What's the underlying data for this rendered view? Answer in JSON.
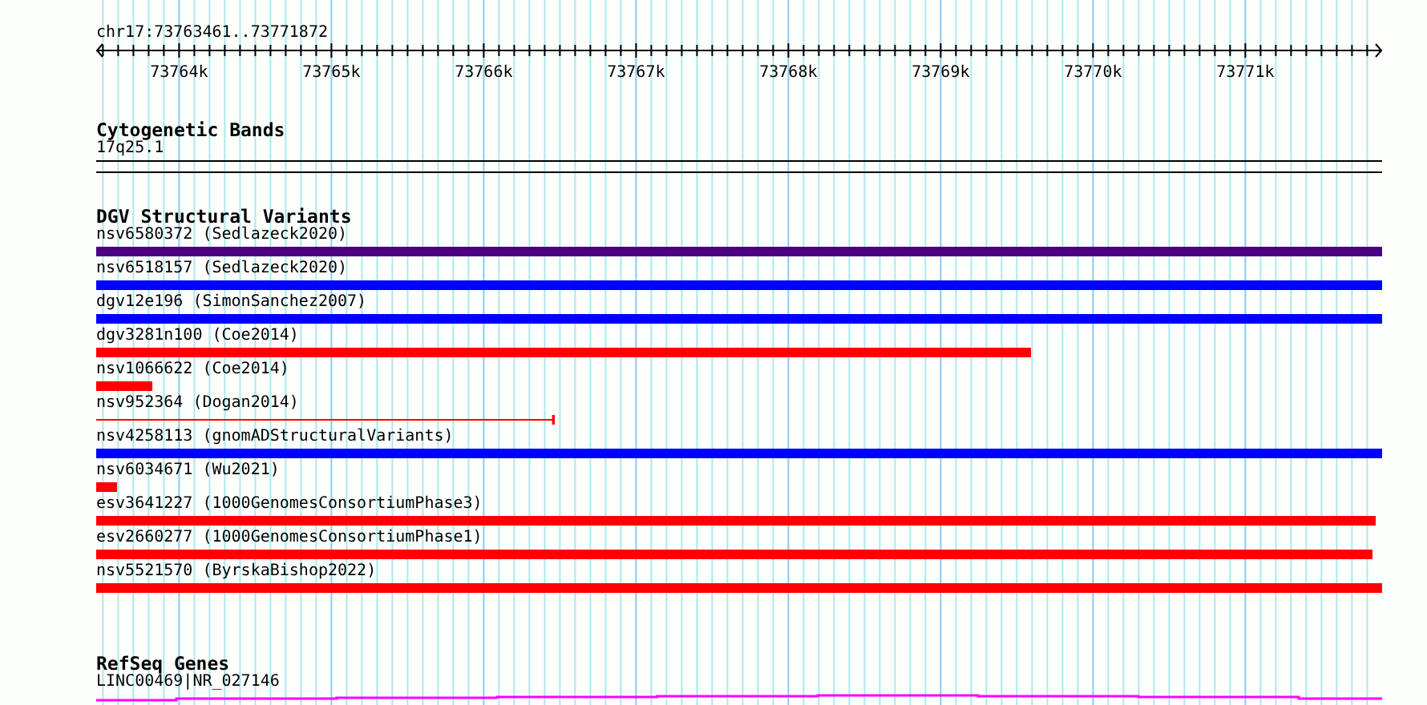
{
  "ruler": {
    "location": "chr17:73763461..73771872",
    "tick_labels": [
      "73764k",
      "73765k",
      "73766k",
      "73767k",
      "73768k",
      "73769k",
      "73770k",
      "73771k"
    ]
  },
  "cytogenetic_bands": {
    "title": "Cytogenetic Bands",
    "band": "17q25.1"
  },
  "dgv_structural_variants": {
    "title": "DGV Structural Variants",
    "variants": [
      {
        "label": "nsv6580372 (Sedlazeck2020)",
        "kind": "bar",
        "color": "#4b0082"
      },
      {
        "label": "nsv6518157 (Sedlazeck2020)",
        "kind": "bar",
        "color": "#0000ff"
      },
      {
        "label": "dgv12e196 (SimonSanchez2007)",
        "kind": "bar",
        "color": "#0000ff"
      },
      {
        "label": "dgv3281n100 (Coe2014)",
        "kind": "bar",
        "color": "#ff0000"
      },
      {
        "label": "nsv1066622 (Coe2014)",
        "kind": "bar",
        "color": "#ff0000"
      },
      {
        "label": "nsv952364 (Dogan2014)",
        "kind": "line",
        "color": "#ff0000"
      },
      {
        "label": "nsv4258113 (gnomADStructuralVariants)",
        "kind": "bar",
        "color": "#0000ff"
      },
      {
        "label": "nsv6034671 (Wu2021)",
        "kind": "bar",
        "color": "#ff0000"
      },
      {
        "label": "esv3641227 (1000GenomesConsortiumPhase3)",
        "kind": "bar",
        "color": "#ff0000"
      },
      {
        "label": "esv2660277 (1000GenomesConsortiumPhase1)",
        "kind": "bar",
        "color": "#ff0000"
      },
      {
        "label": "nsv5521570 (ByrskaBishop2022)",
        "kind": "bar",
        "color": "#ff0000"
      }
    ]
  },
  "refseq_genes": {
    "title": "RefSeq Genes",
    "gene": "LINC00469|NR_027146"
  }
}
